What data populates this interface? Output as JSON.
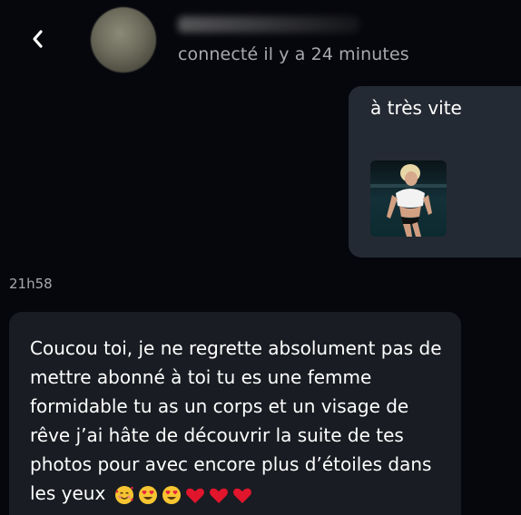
{
  "header": {
    "status_text": "connecté il y a 24 minutes"
  },
  "messages": {
    "outgoing": {
      "text": "à très vite"
    },
    "timestamp": "21h58",
    "incoming": {
      "text": "Coucou toi, je ne regrette absolument pas de mettre abonné à toi tu es une femme formidable tu as un corps et un visage de rêve j’ai hâte de découvrir la suite de tes photos pour avec encore plus d’étoiles dans les yeux",
      "emojis": [
        "smiling-face-with-hearts-emoji",
        "heart-eyes-emoji",
        "heart-eyes-emoji",
        "red-heart-emoji",
        "red-heart-emoji",
        "red-heart-emoji"
      ]
    }
  },
  "colors": {
    "background": "#06070c",
    "outgoing_bubble": "#242a33",
    "incoming_bubble": "#191c22",
    "muted_text": "#a7a9ad"
  }
}
